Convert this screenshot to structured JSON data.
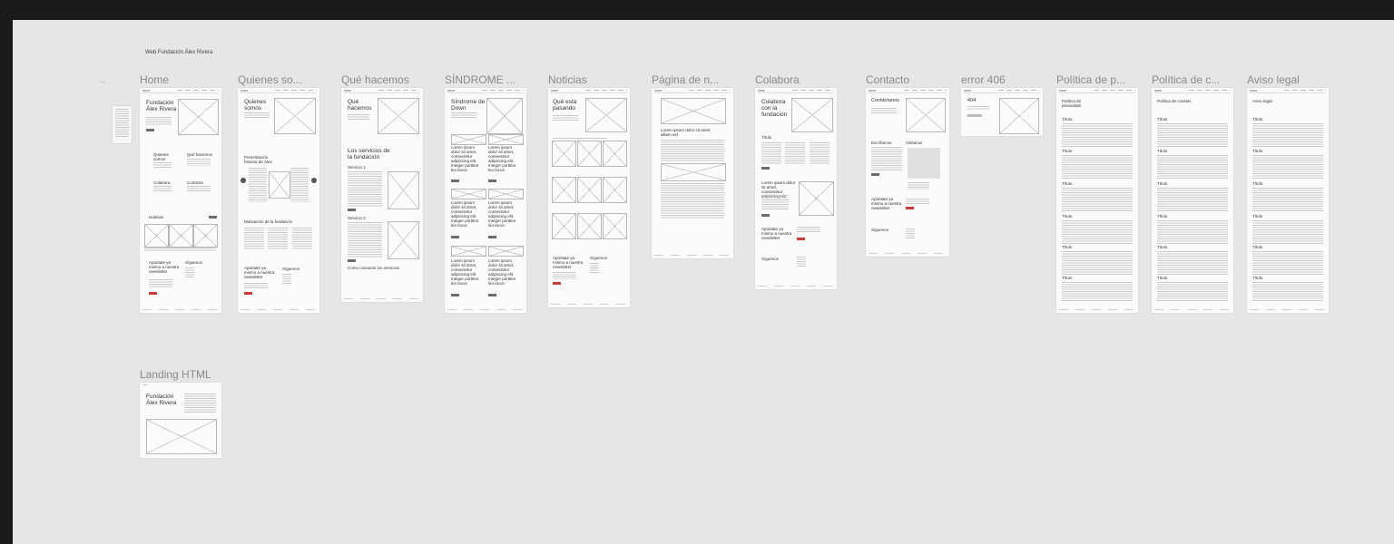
{
  "canvas": {
    "section_title": "Web Fundación Álex Rivera",
    "menu_glyph": "...",
    "frames": [
      {
        "id": "home",
        "label": "Home",
        "heading": "Fundación Álex Rivera",
        "blocks": [
          "Quienes somos",
          "Qué hacemos",
          "Colabora",
          "Contacto",
          "Noticias",
          "Apúntate ya mismo a nuestra newsletter",
          "Síguenos"
        ]
      },
      {
        "id": "quienes",
        "label": "Quienes so...",
        "heading": "Quienes somos",
        "blocks": [
          "Presentación historia de Álex",
          "Motivación de la fundación",
          "Apúntate ya mismo a nuestra newsletter",
          "Síguenos"
        ]
      },
      {
        "id": "que-hacemos",
        "label": "Qué hacemos",
        "heading": "Qué hacemos",
        "blocks": [
          "Los servicios de la fundación",
          "Servicio 1",
          "Servicio 2",
          "Como consumir los servicios"
        ]
      },
      {
        "id": "sindrome",
        "label": "SÍNDROME ...",
        "heading": "Síndrome de Down",
        "blocks": [
          "Lorem ipsum dolor sit amet, consectetur adipiscing elit. Integer porttitor leo lacus"
        ]
      },
      {
        "id": "noticias",
        "label": "Noticias",
        "heading": "Qué está pasando",
        "blocks": [
          "Apúntate ya mismo a nuestra newsletter",
          "Síguenos"
        ]
      },
      {
        "id": "pagina",
        "label": "Página de n...",
        "heading": "Lorem ipsum dolor sit amet alliam est",
        "blocks": []
      },
      {
        "id": "colabora",
        "label": "Colabora",
        "heading": "Colabora con la fundación",
        "blocks": [
          "Título",
          "Lorem ipsum dolor sit amet, consectetur adipiscing elit",
          "Apúntate ya mismo a nuestra newsletter",
          "Síguenos"
        ]
      },
      {
        "id": "contacto",
        "label": "Contacto",
        "heading": "Contáctanos",
        "blocks": [
          "Escríbenos",
          "Visítanos",
          "Apúntate ya mismo a nuestra newsletter",
          "Síguenos"
        ]
      },
      {
        "id": "error",
        "label": "error 406",
        "heading": "404",
        "blocks": []
      },
      {
        "id": "privacidad",
        "label": "Política de p...",
        "heading": "Política de privacidad",
        "blocks": [
          "Título"
        ]
      },
      {
        "id": "cookies",
        "label": "Política de c...",
        "heading": "Política de cookies",
        "blocks": [
          "Título"
        ]
      },
      {
        "id": "aviso",
        "label": "Aviso legal",
        "heading": "Aviso legal",
        "blocks": [
          "Título"
        ]
      },
      {
        "id": "landing",
        "label": "Landing HTML",
        "heading": "Fundación Álex Rivera",
        "blocks": []
      }
    ]
  }
}
